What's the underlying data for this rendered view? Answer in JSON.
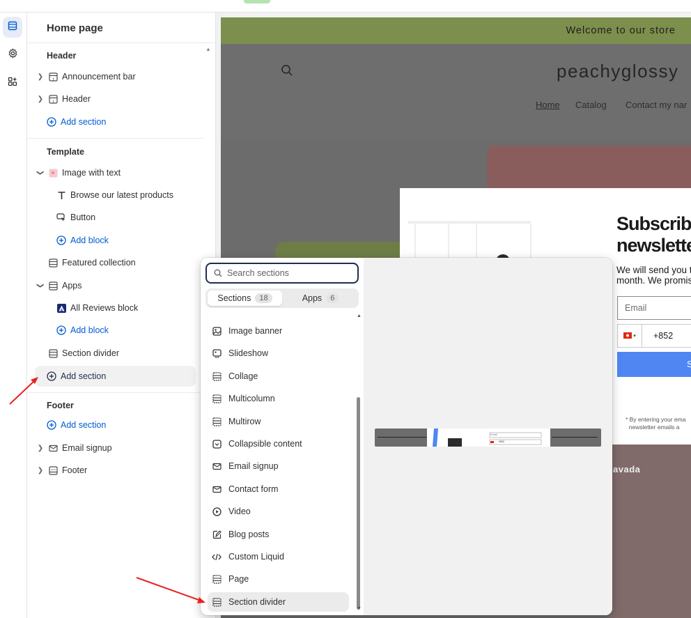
{
  "sidebar": {
    "title": "Home page",
    "groups": {
      "header": "Header",
      "template": "Template",
      "footer": "Footer"
    },
    "header_items": [
      "Announcement bar",
      "Header"
    ],
    "add_section": "Add section",
    "add_block": "Add block",
    "template_items": {
      "image_with_text": "Image with text",
      "browse": "Browse our latest products",
      "button": "Button",
      "featured": "Featured collection",
      "apps": "Apps",
      "reviews": "All Reviews block",
      "divider": "Section divider"
    },
    "footer_items": [
      "Email signup",
      "Footer"
    ]
  },
  "preview": {
    "announcement": "Welcome to our store",
    "brand": "peachyglossy",
    "nav": [
      "Home",
      "Catalog",
      "Contact my nar"
    ],
    "popup": {
      "title_line1": "Subscribe",
      "title_line2": "newslette",
      "text_line1": "We will send you t",
      "text_line2": "month. We promis",
      "email_placeholder": "Email",
      "phone_code": "+852",
      "button": "S",
      "fine_line1": "* By entering your ema",
      "fine_line2": "newsletter emails a"
    },
    "watermark": "avada"
  },
  "picker": {
    "search_placeholder": "Search sections",
    "tabs": [
      {
        "label": "Sections",
        "count": "18"
      },
      {
        "label": "Apps",
        "count": "6"
      }
    ],
    "items": [
      "Image banner",
      "Slideshow",
      "Collage",
      "Multicolumn",
      "Multirow",
      "Collapsible content",
      "Email signup",
      "Contact form",
      "Video",
      "Blog posts",
      "Custom Liquid",
      "Page",
      "Section divider"
    ],
    "selected": "Section divider",
    "thumb_phone": "+852",
    "thumb_email": "Email"
  },
  "colors": {
    "accent": "#005bd3",
    "annotation_arrow": "#e8231f",
    "announcement_bg": "#7d8f4d",
    "popup_button": "#4f86f2"
  }
}
